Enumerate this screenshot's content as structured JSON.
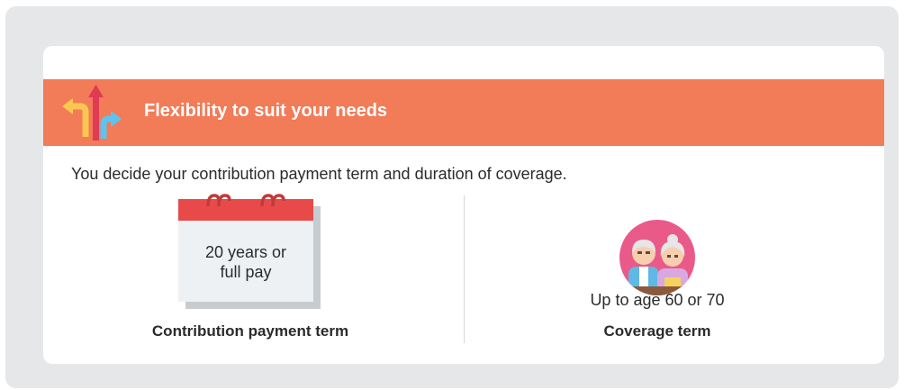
{
  "banner": {
    "title": "Flexibility to suit your needs",
    "icon": "directional-arrows-icon",
    "color": "#f27b58"
  },
  "intro": "You decide your contribution payment term and duration of coverage.",
  "left": {
    "calendar_lines": [
      "20 years or",
      "full pay"
    ],
    "label": "Contribution payment term",
    "icon": "calendar-icon"
  },
  "right": {
    "caption": "Up to age 60 or 70",
    "label": "Coverage term",
    "icon": "elderly-couple-icon"
  },
  "colors": {
    "outer_bg": "#e6e7e9",
    "calendar_red": "#e84a4a",
    "avatar_pink": "#ea5a88"
  }
}
